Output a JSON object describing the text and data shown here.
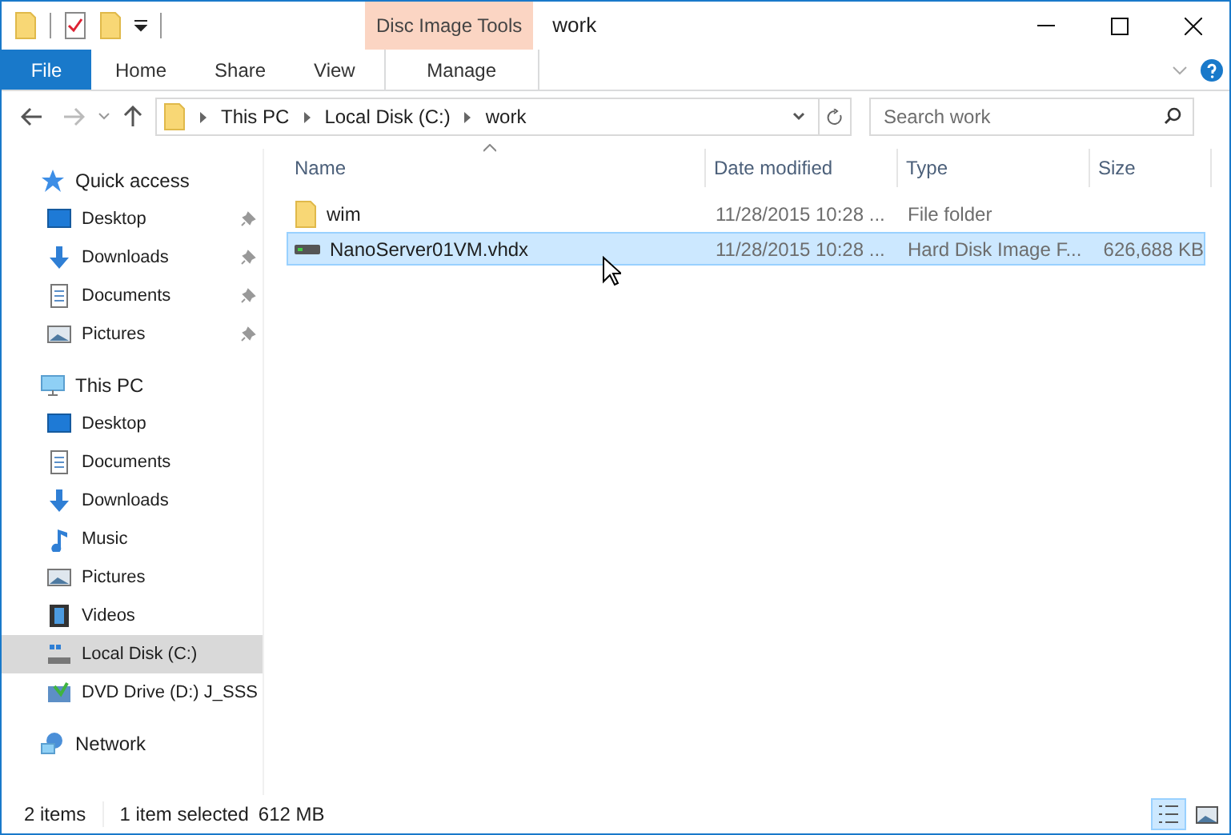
{
  "title_bar": {
    "title": "work",
    "context_group": "Disc Image Tools"
  },
  "ribbon": {
    "tabs": [
      {
        "label": "File",
        "kind": "file"
      },
      {
        "label": "Home",
        "kind": "plain"
      },
      {
        "label": "Share",
        "kind": "plain"
      },
      {
        "label": "View",
        "kind": "plain"
      },
      {
        "label": "Manage",
        "kind": "context"
      }
    ]
  },
  "address": {
    "breadcrumbs": [
      "This PC",
      "Local Disk (C:)",
      "work"
    ]
  },
  "search": {
    "placeholder": "Search work"
  },
  "nav": [
    {
      "label": "Quick access",
      "kind": "star",
      "selected": false,
      "children": [
        {
          "label": "Desktop",
          "kind": "desktop",
          "pinned": true,
          "selected": false
        },
        {
          "label": "Downloads",
          "kind": "downloads",
          "pinned": true,
          "selected": false
        },
        {
          "label": "Documents",
          "kind": "documents",
          "pinned": true,
          "selected": false
        },
        {
          "label": "Pictures",
          "kind": "pictures",
          "pinned": true,
          "selected": false
        }
      ]
    },
    {
      "label": "This PC",
      "kind": "pc",
      "selected": false,
      "children": [
        {
          "label": "Desktop",
          "kind": "desktop",
          "pinned": false,
          "selected": false
        },
        {
          "label": "Documents",
          "kind": "documents",
          "pinned": false,
          "selected": false
        },
        {
          "label": "Downloads",
          "kind": "downloads",
          "pinned": false,
          "selected": false
        },
        {
          "label": "Music",
          "kind": "music",
          "pinned": false,
          "selected": false
        },
        {
          "label": "Pictures",
          "kind": "pictures",
          "pinned": false,
          "selected": false
        },
        {
          "label": "Videos",
          "kind": "videos",
          "pinned": false,
          "selected": false
        },
        {
          "label": "Local Disk (C:)",
          "kind": "drive",
          "pinned": false,
          "selected": true
        },
        {
          "label": "DVD Drive (D:) J_SSS",
          "kind": "dvd",
          "pinned": false,
          "selected": false
        }
      ]
    },
    {
      "label": "Network",
      "kind": "network",
      "selected": false
    }
  ],
  "columns": [
    {
      "label": "Name",
      "sorted": true
    },
    {
      "label": "Date modified"
    },
    {
      "label": "Type"
    },
    {
      "label": "Size"
    }
  ],
  "rows": [
    {
      "kind": "folder",
      "name": "wim",
      "date": "11/28/2015 10:28 ...",
      "type": "File folder",
      "selected": false
    },
    {
      "kind": "disk",
      "name": "NanoServer01VM.vhdx",
      "date": "11/28/2015 10:28 ...",
      "type": "Hard Disk Image F...",
      "size": "626,688 KB",
      "selected": true
    }
  ],
  "status_bar": {
    "count": "2 items",
    "selection": "1 item selected",
    "selection_size": "612 MB",
    "views": [
      {
        "kind": "details",
        "selected": true
      },
      {
        "kind": "thumbnails",
        "selected": false
      }
    ]
  }
}
